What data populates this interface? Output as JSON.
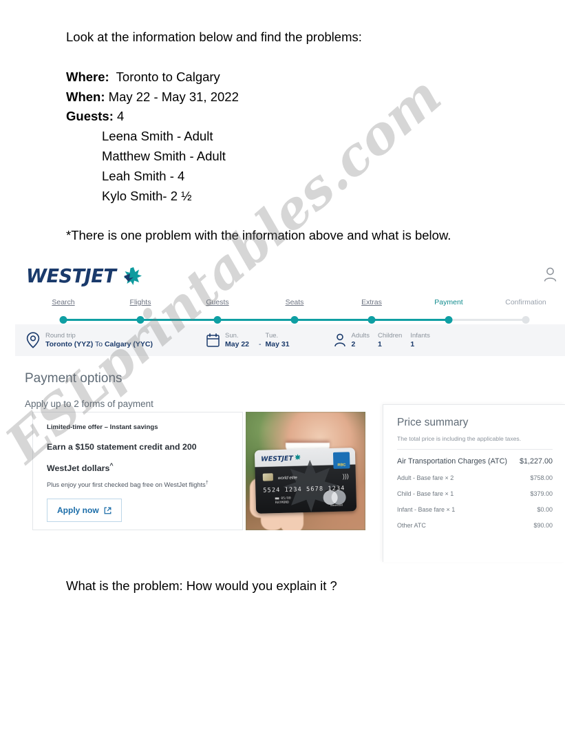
{
  "worksheet": {
    "intro": "Look at the information below and find the problems:",
    "where_label": "Where:",
    "where_value": "  Toronto to Calgary",
    "when_label": "When:",
    "when_value": " May 22 - May 31, 2022",
    "guests_label": "Guests:",
    "guests_value": " 4",
    "guest_list": [
      "Leena Smith - Adult",
      "Matthew Smith - Adult",
      "Leah Smith - 4",
      "Kylo Smith- 2 ½"
    ],
    "note": "*There is one problem with the information above and what is below.",
    "question": "What is the problem: How would you explain it ?"
  },
  "watermark": {
    "text": "ESLprintables.com"
  },
  "screenshot": {
    "brand": {
      "wordmark": "WESTJET",
      "account_icon": "account-person-icon",
      "leaf_icon": "maple-leaf-icon"
    },
    "stepper": {
      "steps": [
        {
          "label": "Search",
          "state": "done"
        },
        {
          "label": "Flights",
          "state": "done"
        },
        {
          "label": "Guests",
          "state": "done"
        },
        {
          "label": "Seats",
          "state": "done"
        },
        {
          "label": "Extras",
          "state": "done"
        },
        {
          "label": "Payment",
          "state": "current"
        },
        {
          "label": "Confirmation",
          "state": "upcoming"
        }
      ],
      "colors": {
        "done": "#0f9fa3",
        "todo": "#e0e3e6",
        "current_text": "#0f8b8d"
      }
    },
    "trip_bar": {
      "route_icon": "location-pin-icon",
      "trip_type": "Round trip",
      "origin": "Toronto (YYZ)",
      "connector": " To ",
      "destination": "Calgary (YYC)",
      "calendar_icon": "calendar-icon",
      "depart_day": "Sun.",
      "depart_date": "May 22",
      "date_separator": "-",
      "return_day": "Tue.",
      "return_date": "May 31",
      "passenger_icon": "person-icon",
      "pax": [
        {
          "label": "Adults",
          "count": "2"
        },
        {
          "label": "Children",
          "count": "1"
        },
        {
          "label": "Infants",
          "count": "1"
        }
      ]
    },
    "payment": {
      "title": "Payment options",
      "subtitle": "Apply up to 2 forms of payment"
    },
    "offer": {
      "kicker": "Limited-time offer – Instant savings",
      "headline_line1": "Earn a $150 statement credit and 200",
      "headline_line2": "WestJet dollars",
      "headline_sup": "^",
      "fine_print": "Plus enjoy your first checked bag free on WestJet flights",
      "fine_print_sup": "†",
      "apply_label": "Apply now",
      "apply_icon": "external-link-icon"
    },
    "card_image": {
      "alt": "hand-holding-westjet-rbc-card-photo",
      "card_brand": "WESTJET",
      "bank": "RBC",
      "tier": "world elite",
      "number": "5524 1234 5678 1234",
      "expiry_line1": "■■ 05/00",
      "expiry_line2": "RAYMOND",
      "network": "mastercard",
      "contactless_icon": "contactless-icon"
    },
    "price_summary": {
      "title": "Price summary",
      "subtitle": "The total price is including the applicable taxes.",
      "rows": [
        {
          "label": "Air Transportation Charges (ATC)",
          "value": "$1,227.00",
          "emphasis": true
        },
        {
          "label": "Adult - Base fare × 2",
          "value": "$758.00",
          "emphasis": false
        },
        {
          "label": "Child - Base fare × 1",
          "value": "$379.00",
          "emphasis": false
        },
        {
          "label": "Infant - Base fare × 1",
          "value": "$0.00",
          "emphasis": false
        },
        {
          "label": "Other ATC",
          "value": "$90.00",
          "emphasis": false
        }
      ]
    }
  }
}
